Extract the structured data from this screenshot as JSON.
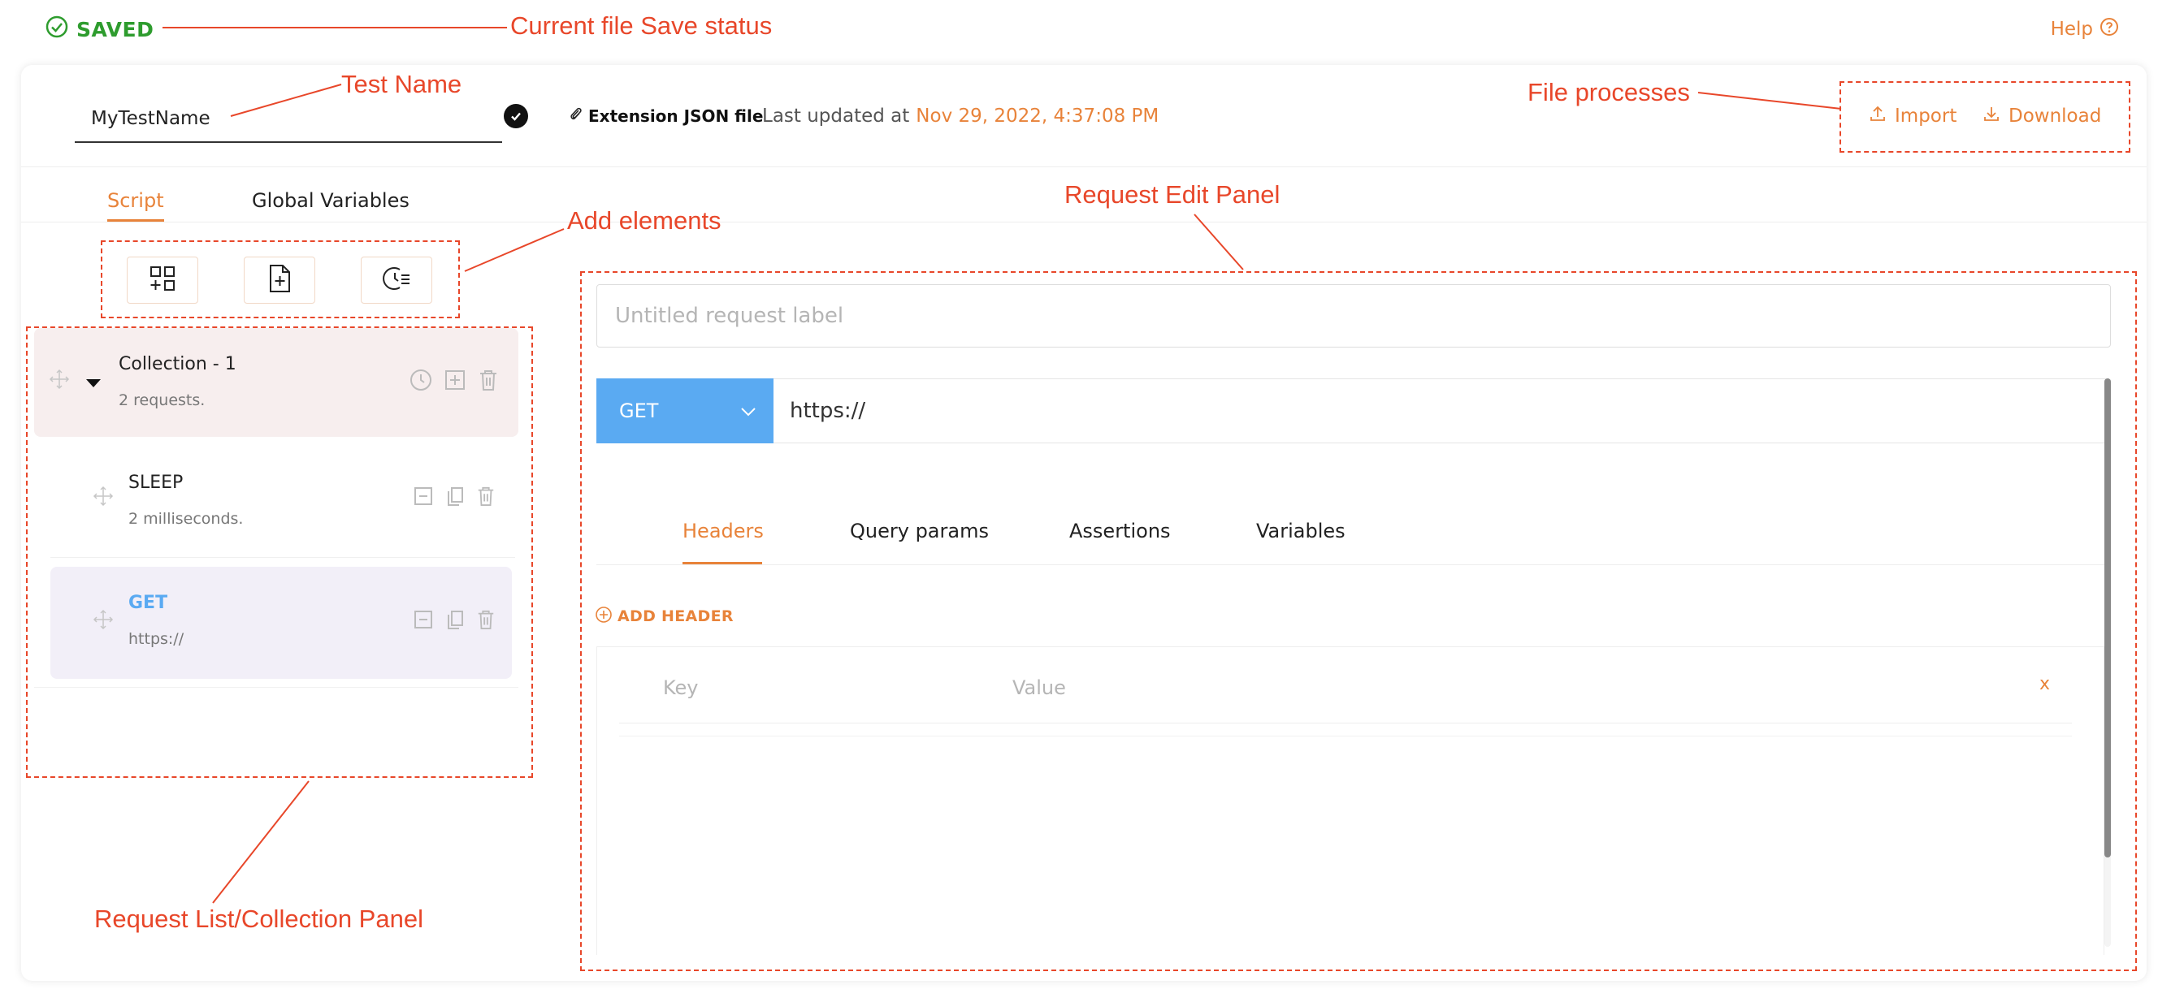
{
  "status": {
    "save_label": "SAVED"
  },
  "help": {
    "label": "Help"
  },
  "header": {
    "test_name": "MyTestName",
    "extension_label": "Extension JSON file",
    "last_updated_prefix": "Last updated at",
    "last_updated_time": "Nov 29, 2022, 4:37:08 PM",
    "import_label": "Import",
    "download_label": "Download"
  },
  "tabs": [
    {
      "label": "Script",
      "active": true
    },
    {
      "label": "Global Variables",
      "active": false
    }
  ],
  "request_list": {
    "collection": {
      "title": "Collection - 1",
      "subtitle": "2 requests."
    },
    "items": [
      {
        "title": "SLEEP",
        "subtitle": "2 milliseconds."
      },
      {
        "title": "GET",
        "subtitle": "https://"
      }
    ]
  },
  "request_edit": {
    "label_placeholder": "Untitled request label",
    "method": "GET",
    "url": "https://",
    "subtabs": [
      "Headers",
      "Query params",
      "Assertions",
      "Variables"
    ],
    "add_header_label": "ADD HEADER",
    "key_placeholder": "Key",
    "value_placeholder": "Value",
    "remove_label": "x"
  },
  "annotations": {
    "save_status": "Current file Save status",
    "test_name": "Test Name",
    "file_processes": "File processes",
    "add_elements": "Add elements",
    "request_edit_panel": "Request Edit Panel",
    "request_list_panel": "Request List/Collection Panel"
  },
  "colors": {
    "accent": "#e8833a",
    "saved_green": "#2e9c2e",
    "method_blue": "#5aaaf2",
    "annotation_red": "#e8472a"
  }
}
